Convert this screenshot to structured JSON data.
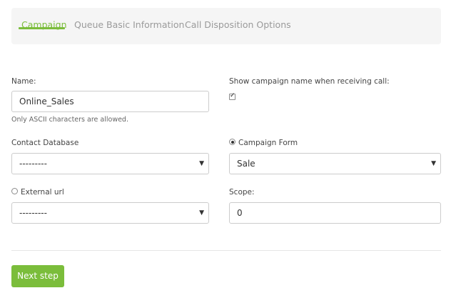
{
  "tabs": [
    {
      "label": "Campaign",
      "active": true
    },
    {
      "label": "Queue Basic Information",
      "active": false
    },
    {
      "label": "Call Disposition Options",
      "active": false
    }
  ],
  "form": {
    "name": {
      "label": "Name:",
      "value": "Online_Sales",
      "help": "Only ASCII characters are allowed."
    },
    "show_campaign_name": {
      "label": "Show campaign name when receiving call:",
      "checked": true
    },
    "contact_database": {
      "label": "Contact Database",
      "selected": "---------"
    },
    "campaign_form": {
      "label": "Campaign Form",
      "radio_selected": true,
      "selected": "Sale"
    },
    "external_url": {
      "label": "External url",
      "radio_selected": false,
      "selected": "---------"
    },
    "scope": {
      "label": "Scope:",
      "value": "0"
    }
  },
  "actions": {
    "next_step_label": "Next step"
  },
  "colors": {
    "accent": "#7bbd3b",
    "tab_inactive": "#9a9a9a",
    "tabs_background": "#f5f5f5"
  },
  "icons": {
    "select_arrow": "caret-down-icon",
    "checkbox": "checkbox-checked-icon"
  }
}
